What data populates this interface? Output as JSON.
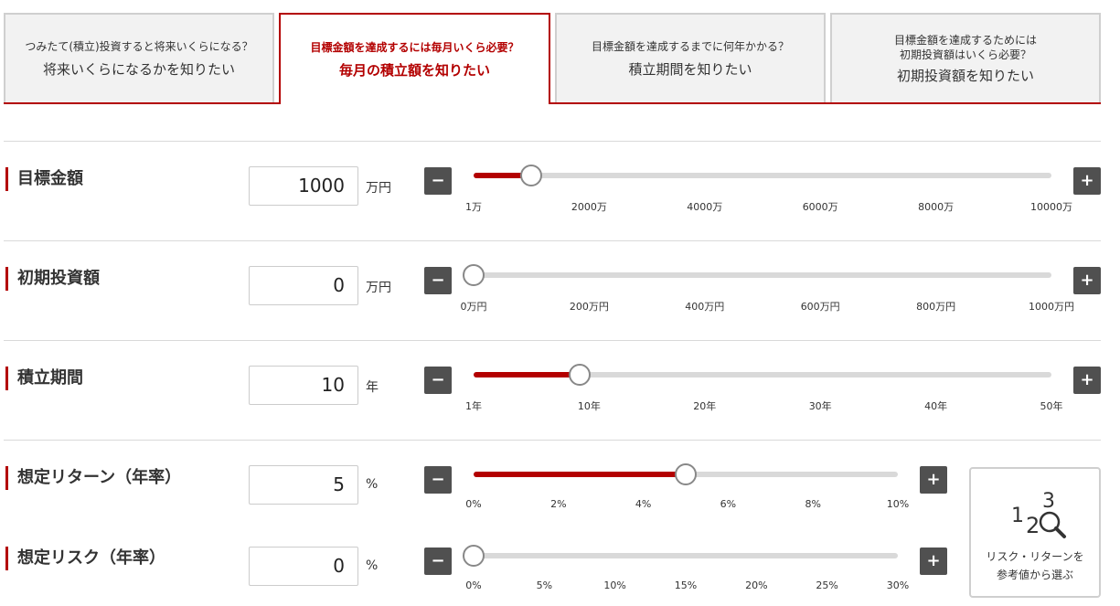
{
  "tabs": [
    {
      "sub": "つみたて(積立)投資すると将来いくらになる？",
      "main": "将来いくらになるかを知りたい"
    },
    {
      "sub": "目標金額を達成するには毎月いくら必要？",
      "main": "毎月の積立額を知りたい"
    },
    {
      "sub": "目標金額を達成するまでに何年かかる？",
      "main": "積立期間を知りたい"
    },
    {
      "sub1": "目標金額を達成するためには",
      "sub2": "初期投資額はいくら必要？",
      "main": "初期投資額を知りたい"
    }
  ],
  "sliders": {
    "target": {
      "label": "目標金額",
      "value": "1000",
      "unit": "万円",
      "fraction": 0.0999,
      "ticks": [
        "1万",
        "2000万",
        "4000万",
        "6000万",
        "8000万",
        "10000万"
      ]
    },
    "initial": {
      "label": "初期投資額",
      "value": "0",
      "unit": "万円",
      "fraction": 0.0,
      "ticks": [
        "0万円",
        "200万円",
        "400万円",
        "600万円",
        "800万円",
        "1000万円"
      ]
    },
    "period": {
      "label": "積立期間",
      "value": "10",
      "unit": "年",
      "fraction": 0.1837,
      "ticks": [
        "1年",
        "10年",
        "20年",
        "30年",
        "40年",
        "50年"
      ]
    },
    "return": {
      "label": "想定リターン（年率）",
      "value": "5",
      "unit": "%",
      "fraction": 0.5,
      "ticks": [
        "0%",
        "2%",
        "4%",
        "6%",
        "8%",
        "10%"
      ]
    },
    "risk": {
      "label": "想定リスク（年率）",
      "value": "0",
      "unit": "%",
      "fraction": 0.0,
      "ticks": [
        "0%",
        "5%",
        "10%",
        "15%",
        "20%",
        "25%",
        "30%"
      ]
    }
  },
  "buttons": {
    "minus": "−",
    "plus": "+"
  },
  "riskbox": {
    "line1": "リスク・リターンを",
    "line2": "参考値から選ぶ",
    "icon": "numbers-magnifier-icon"
  },
  "colors": {
    "accent": "#b30000",
    "track": "#d9d9d9",
    "button": "#505050"
  }
}
